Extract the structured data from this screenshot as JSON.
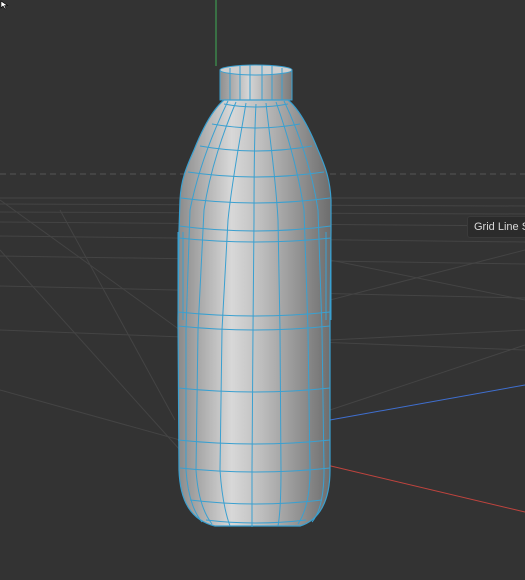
{
  "viewport": {
    "tooltip_text": "Grid Line S",
    "background_color": "#333333",
    "wireframe_color": "#3aa0d0",
    "axis_colors": {
      "x": "#c0443e",
      "y": "#3fae55",
      "z": "#3f6fd0"
    }
  },
  "scene": {
    "object": "bottle-mesh",
    "cursor": "pointer-cursor-icon"
  }
}
